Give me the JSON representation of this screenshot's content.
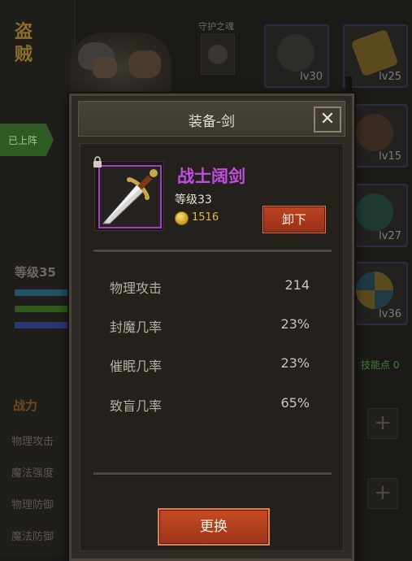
{
  "background": {
    "character_name": "盗贼",
    "guardian_label": "守护之魂",
    "on_list_tag": "已上阵",
    "level_text": "等级35",
    "power_label": "战力",
    "stat_labels": [
      "物理攻击",
      "魔法强度",
      "物理防御",
      "魔法防御"
    ],
    "skill_points": "技能点 0",
    "equipment_slots": [
      {
        "icon": "helmet-icon",
        "level": "lv30"
      },
      {
        "icon": "gold-bar-necklace-icon",
        "level": "lv25"
      },
      {
        "icon": "leather-belt-icon",
        "level": "lv15"
      },
      {
        "icon": "ring-icon",
        "level": "lv27"
      },
      {
        "icon": "shield-icon",
        "level": "lv36"
      }
    ],
    "plus_symbol": "+"
  },
  "modal": {
    "title": "装备-剑",
    "close_symbol": "✕",
    "item": {
      "name": "战士阔剑",
      "level": "等级33",
      "price": "1516",
      "rarity_color": "#c04fe0",
      "icon": "sword-icon",
      "locked": true
    },
    "unequip_label": "卸下",
    "stats": [
      {
        "name": "物理攻击",
        "value": "214"
      },
      {
        "name": "封魔几率",
        "value": "23%"
      },
      {
        "name": "催眠几率",
        "value": "23%"
      },
      {
        "name": "致盲几率",
        "value": "65%"
      }
    ],
    "replace_label": "更换"
  }
}
